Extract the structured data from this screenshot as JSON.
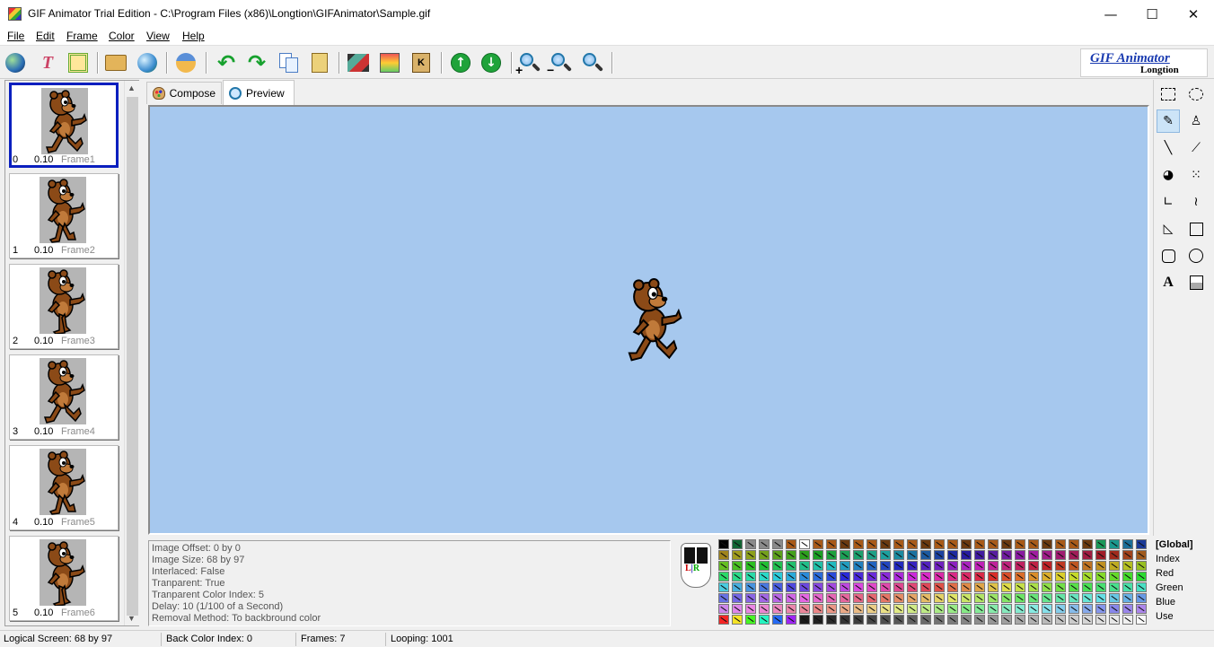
{
  "window": {
    "title": "GIF Animator Trial Edition - C:\\Program Files (x86)\\Longtion\\GIFAnimator\\Sample.gif",
    "minimize": "—",
    "maximize": "☐",
    "close": "✕"
  },
  "menu": [
    "File",
    "Edit",
    "Frame",
    "Color",
    "View",
    "Help"
  ],
  "logo": {
    "line1": "GIF Animator",
    "line2": "Longtion"
  },
  "tabs": [
    {
      "label": "Compose",
      "icon": "palette-icon",
      "active": false
    },
    {
      "label": "Preview",
      "icon": "magnifier-icon",
      "active": true
    }
  ],
  "frames": [
    {
      "index": "0",
      "delay": "0.10",
      "name": "Frame1",
      "selected": true
    },
    {
      "index": "1",
      "delay": "0.10",
      "name": "Frame2",
      "selected": false
    },
    {
      "index": "2",
      "delay": "0.10",
      "name": "Frame3",
      "selected": false
    },
    {
      "index": "3",
      "delay": "0.10",
      "name": "Frame4",
      "selected": false
    },
    {
      "index": "4",
      "delay": "0.10",
      "name": "Frame5",
      "selected": false
    },
    {
      "index": "5",
      "delay": "0.10",
      "name": "Frame6",
      "selected": false
    }
  ],
  "info": [
    "Image Offset: 0 by 0",
    "Image Size: 68 by 97",
    "Interlaced: False",
    "Tranparent: True",
    "Tranparent Color Index: 5",
    "Delay: 10 (1/100 of a Second)",
    "Removal Method: To backbround color"
  ],
  "mouse_label": {
    "left": "L",
    "sep": "|",
    "right": "R"
  },
  "color_panel": [
    "[Global]",
    "Index",
    "Red",
    "Green",
    "Blue",
    "Use"
  ],
  "status": {
    "logical_screen": "Logical Screen: 68 by 97",
    "back_color": "Back Color Index: 0",
    "frames": "Frames: 7",
    "looping": "Looping: 1001"
  },
  "colors": {
    "canvas_bg": "#a6c8ee",
    "selection": "#0a1fbf",
    "bear": "#8b4a17"
  }
}
